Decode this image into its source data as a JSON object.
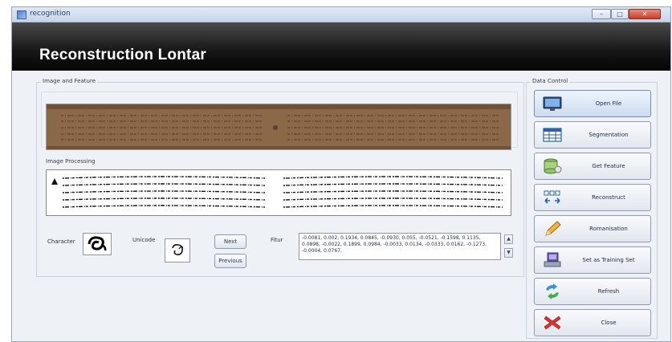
{
  "window": {
    "title": "recognition",
    "controls": {
      "minimize": "",
      "maximize": "",
      "close": ""
    }
  },
  "banner": {
    "title": "Reconstruction Lontar"
  },
  "image_feature": {
    "group_label": "Image and Feature",
    "processing_label": "Image Processing"
  },
  "feature_row": {
    "character_label": "Character",
    "unicode_label": "Unicode",
    "next_label": "Next",
    "previous_label": "Previous",
    "fitur_label": "Fitur",
    "fitur_value": "-0.0081, 0.002, 0.1934, 0.0845, -0.0930, 0.055, -0.0521, -0.1598, 0.1135, 0.0898, -0.0022, 0.1899, 0.0984, -0.0033, 0.0134, -0.0333, 0.0162, -0.1273, -0.0004, 0.0767,"
  },
  "data_control": {
    "group_label": "Data Control",
    "buttons": [
      {
        "label": "Open File",
        "icon": "monitor-icon"
      },
      {
        "label": "Segmentation",
        "icon": "table-icon"
      },
      {
        "label": "Get Feature",
        "icon": "database-icon"
      },
      {
        "label": "Reconstruct",
        "icon": "blocks-arrows-icon"
      },
      {
        "label": "Romanisation",
        "icon": "pencil-icon"
      },
      {
        "label": "Set as Training Set",
        "icon": "computer-icon"
      },
      {
        "label": "Refresh",
        "icon": "refresh-icon"
      },
      {
        "label": "Close",
        "icon": "close-x-icon"
      }
    ]
  },
  "colors": {
    "banner": "#161616",
    "palm_leaf": "#8c6a4b",
    "window_bg": "#eef1f6",
    "close_button": "#c7402c"
  }
}
